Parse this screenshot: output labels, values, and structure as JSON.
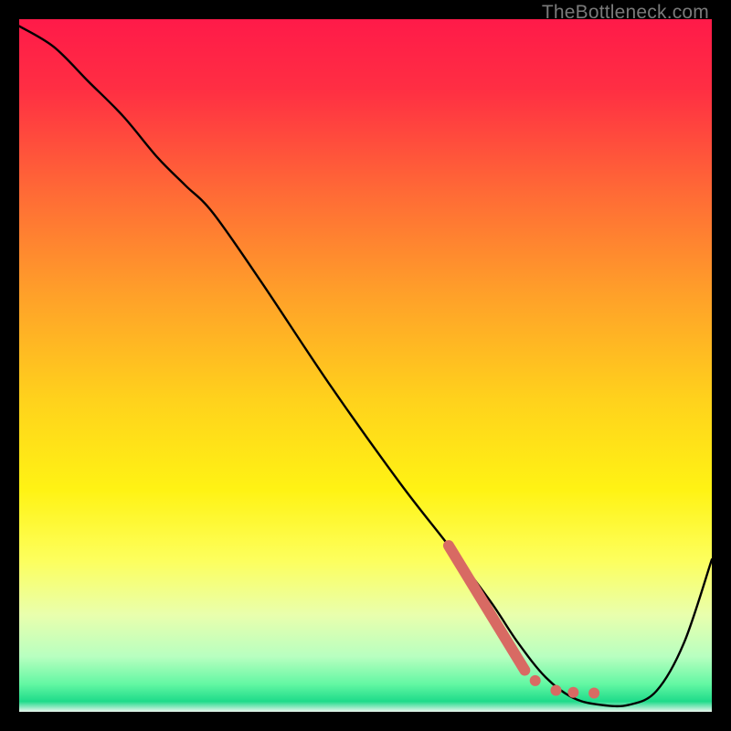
{
  "watermark": "TheBottleneck.com",
  "chart_data": {
    "type": "line",
    "title": "",
    "xlabel": "",
    "ylabel": "",
    "xlim": [
      0,
      100
    ],
    "ylim": [
      0,
      100
    ],
    "background_gradient": {
      "stops": [
        {
          "offset": 0.0,
          "color": "#ff1a49"
        },
        {
          "offset": 0.1,
          "color": "#ff2e43"
        },
        {
          "offset": 0.25,
          "color": "#ff6a36"
        },
        {
          "offset": 0.4,
          "color": "#ffa129"
        },
        {
          "offset": 0.55,
          "color": "#ffd21c"
        },
        {
          "offset": 0.68,
          "color": "#fff314"
        },
        {
          "offset": 0.78,
          "color": "#fdff5c"
        },
        {
          "offset": 0.86,
          "color": "#e9ffad"
        },
        {
          "offset": 0.92,
          "color": "#b8ffc0"
        },
        {
          "offset": 0.96,
          "color": "#63f7a3"
        },
        {
          "offset": 0.985,
          "color": "#1edb8a"
        },
        {
          "offset": 1.0,
          "color": "#e8f5ed"
        }
      ]
    },
    "series": [
      {
        "name": "curve",
        "x": [
          0,
          5,
          10,
          15,
          20,
          24,
          28,
          35,
          45,
          55,
          62,
          68,
          72,
          76,
          80,
          84,
          88,
          92,
          96,
          100
        ],
        "y": [
          99,
          96,
          91,
          86,
          80,
          76,
          72,
          62,
          47,
          33,
          24,
          16,
          10,
          5,
          2,
          1,
          1,
          3,
          10,
          22
        ]
      }
    ],
    "highlight_segment": {
      "name": "highlight-slope",
      "color": "#d86a63",
      "points": [
        {
          "x": 62,
          "y": 24
        },
        {
          "x": 73,
          "y": 6
        }
      ],
      "width": 12
    },
    "highlight_dots": {
      "name": "highlight-dots",
      "color": "#d86a63",
      "r": 6,
      "points": [
        {
          "x": 74.5,
          "y": 4.5
        },
        {
          "x": 77.5,
          "y": 3.1
        },
        {
          "x": 80.0,
          "y": 2.8
        },
        {
          "x": 83.0,
          "y": 2.7
        }
      ]
    }
  }
}
